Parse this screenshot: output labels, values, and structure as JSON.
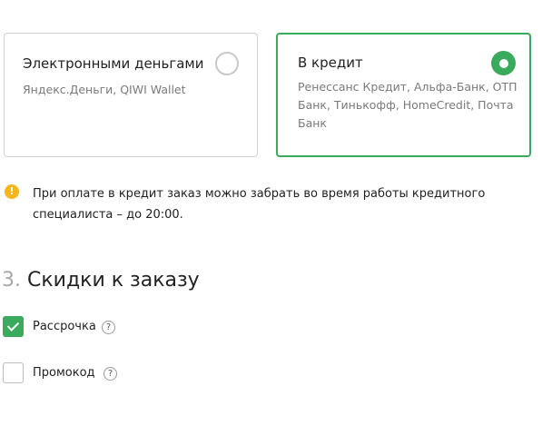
{
  "payment_options": [
    {
      "title": "Электронными деньгами",
      "description": "Яндекс.Деньги, QIWI Wallet",
      "selected": false
    },
    {
      "title": "В кредит",
      "description": "Ренессанс Кредит, Альфа-Банк, ОТП Банк, Тинькофф, HomeCredit, Почта Банк",
      "selected": true
    }
  ],
  "info": {
    "icon": "info-icon",
    "icon_glyph": "!",
    "text": "При оплате в кредит заказ можно забрать во время работы кредитного специалиста – до 20:00."
  },
  "discounts": {
    "number": "3.",
    "title": "Скидки к заказу",
    "options": [
      {
        "label": "Рассрочка",
        "checked": true,
        "help": "?"
      },
      {
        "label": "Промокод",
        "checked": false,
        "help": "?"
      }
    ]
  },
  "colors": {
    "accent": "#3aaa5c",
    "warning": "#f5b61a",
    "muted_text": "#7a7a7a",
    "border": "#d2d2d2"
  }
}
